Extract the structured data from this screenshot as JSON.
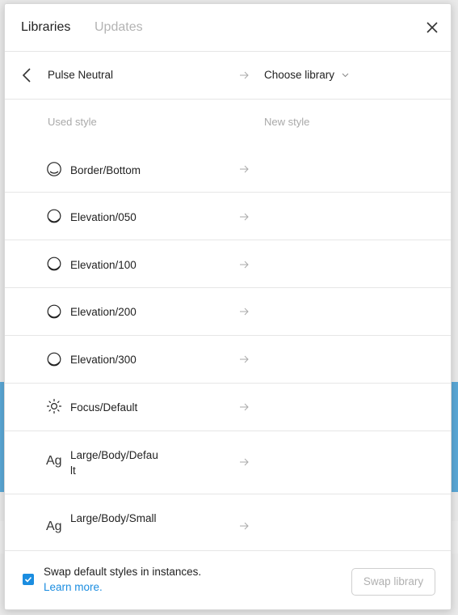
{
  "tabs": [
    {
      "label": "Libraries",
      "active": true
    },
    {
      "label": "Updates",
      "active": false
    }
  ],
  "header": {
    "library_name": "Pulse Neutral",
    "choose_label": "Choose library"
  },
  "columns": {
    "used": "Used style",
    "new": "New style"
  },
  "styles": [
    {
      "label": "Border/Bottom",
      "icon": "effect-icon"
    },
    {
      "label": "Elevation/050",
      "icon": "effect-icon"
    },
    {
      "label": "Elevation/100",
      "icon": "effect-icon"
    },
    {
      "label": "Elevation/200",
      "icon": "effect-icon"
    },
    {
      "label": "Elevation/300",
      "icon": "effect-icon"
    },
    {
      "label": "Focus/Default",
      "icon": "sun-icon"
    },
    {
      "label": "Large/Body/Default",
      "icon": "text-style-icon",
      "glyph": "Ag"
    },
    {
      "label": "Large/Body/Small",
      "icon": "text-style-icon",
      "glyph": "Ag"
    }
  ],
  "footer": {
    "checkbox_checked": true,
    "swap_text": "Swap default styles in instances.",
    "learn_more": "Learn more.",
    "swap_button": "Swap library"
  },
  "colors": {
    "accent": "#1b8de0",
    "canvas_selection": "#5aa7d6"
  }
}
